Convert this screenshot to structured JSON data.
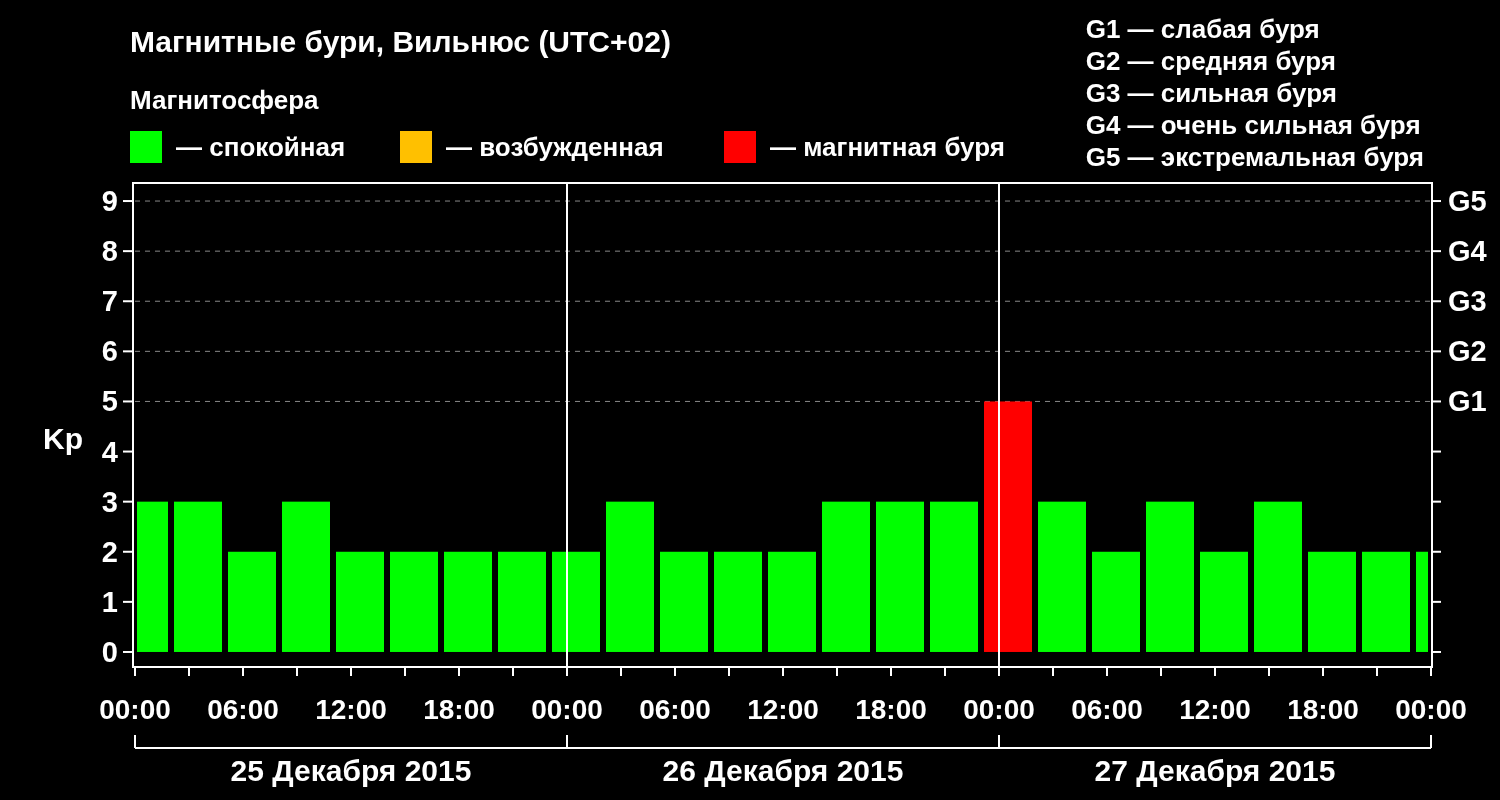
{
  "title": "Магнитные бури, Вильнюс (UTC+02)",
  "legend": {
    "title": "Магнитосфера"
  },
  "scale": [
    "G1 — слабая буря",
    "G2 — средняя буря",
    "G3 — сильная буря",
    "G4 — очень сильная буря",
    "G5 — экстремальная буря"
  ],
  "chart": {
    "right_axis_labels": [
      "G5",
      "G4",
      "G3",
      "G2",
      "G1"
    ],
    "days": [
      "25 Декабря 2015",
      "26 Декабря 2015",
      "27 Декабря 2015"
    ],
    "chart_data": {
      "type": "bar",
      "ylabel": "Kp",
      "grid": true,
      "x": [
        "2015-12-25T00:55",
        "2015-12-25T03:30",
        "2015-12-25T06:30",
        "2015-12-25T09:30",
        "2015-12-25T12:30",
        "2015-12-25T15:30",
        "2015-12-25T18:30",
        "2015-12-25T21:30",
        "2015-12-26T00:30",
        "2015-12-26T03:30",
        "2015-12-26T06:30",
        "2015-12-26T09:30",
        "2015-12-26T12:30",
        "2015-12-26T15:30",
        "2015-12-26T18:30",
        "2015-12-26T21:30",
        "2015-12-27T00:30",
        "2015-12-27T03:30",
        "2015-12-27T06:30",
        "2015-12-27T09:30",
        "2015-12-27T12:30",
        "2015-12-27T15:30",
        "2015-12-27T18:30",
        "2015-12-27T21:30",
        "2015-12-27T23:35"
      ],
      "series": [
        {
          "name": "— спокойная",
          "color": "#00ff00",
          "values": [
            3,
            3,
            2,
            3,
            2,
            2,
            2,
            2,
            2,
            3,
            2,
            2,
            2,
            3,
            3,
            3,
            null,
            3,
            2,
            3,
            2,
            3,
            2,
            2,
            2
          ]
        },
        {
          "name": "— возбужденная",
          "color": "#ffc000",
          "values": [
            null,
            null,
            null,
            null,
            null,
            null,
            null,
            null,
            null,
            null,
            null,
            null,
            null,
            null,
            null,
            null,
            null,
            null,
            null,
            null,
            null,
            null,
            null,
            null,
            null
          ]
        },
        {
          "name": "— магнитная буря",
          "color": "#ff0000",
          "values": [
            null,
            null,
            null,
            null,
            null,
            null,
            null,
            null,
            null,
            null,
            null,
            null,
            null,
            null,
            null,
            null,
            5,
            null,
            null,
            null,
            null,
            null,
            null,
            null,
            null
          ]
        }
      ],
      "xlim": [
        "2015-12-25T00:00",
        "2015-12-28T00:00"
      ],
      "ylim": [
        -0.3,
        9.36
      ],
      "xticks": [
        {
          "value": "2015-12-25T00:00",
          "label": "00:00"
        },
        {
          "value": "2015-12-25T06:00",
          "label": "06:00"
        },
        {
          "value": "2015-12-25T12:00",
          "label": "12:00"
        },
        {
          "value": "2015-12-25T18:00",
          "label": "18:00"
        },
        {
          "value": "2015-12-26T00:00",
          "label": "00:00"
        },
        {
          "value": "2015-12-26T06:00",
          "label": "06:00"
        },
        {
          "value": "2015-12-26T12:00",
          "label": "12:00"
        },
        {
          "value": "2015-12-26T18:00",
          "label": "18:00"
        },
        {
          "value": "2015-12-27T00:00",
          "label": "00:00"
        },
        {
          "value": "2015-12-27T06:00",
          "label": "06:00"
        },
        {
          "value": "2015-12-27T12:00",
          "label": "12:00"
        },
        {
          "value": "2015-12-27T18:00",
          "label": "18:00"
        },
        {
          "value": "2015-12-28T00:00",
          "label": "00:00"
        }
      ],
      "yticks": [
        0,
        1,
        2,
        3,
        4,
        5,
        6,
        7,
        8,
        9
      ]
    }
  }
}
